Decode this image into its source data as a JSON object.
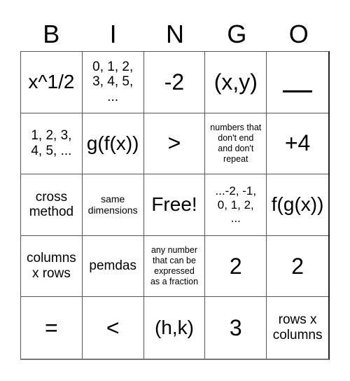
{
  "header": {
    "letters": [
      "B",
      "I",
      "N",
      "G",
      "O"
    ]
  },
  "cells": [
    [
      "x^1/2",
      "0, 1, 2,\n3, 4, 5,\n...",
      "-2",
      "(x,y)",
      "__"
    ],
    [
      "1, 2, 3,\n4, 5, ...",
      "g(f(x))",
      ">",
      "numbers that\ndon't end\nand don't\nrepeat",
      "+4"
    ],
    [
      "cross\nmethod",
      "same\ndimensions",
      "Free!",
      "...-2, -1,\n0, 1, 2,\n...",
      "f(g(x))"
    ],
    [
      "columns\nx rows",
      "pemdas",
      "any number\nthat can be\nexpressed\nas a fraction",
      "2",
      "2"
    ],
    [
      "=",
      "<",
      "(h,k)",
      "3",
      "rows x\ncolumns"
    ]
  ]
}
